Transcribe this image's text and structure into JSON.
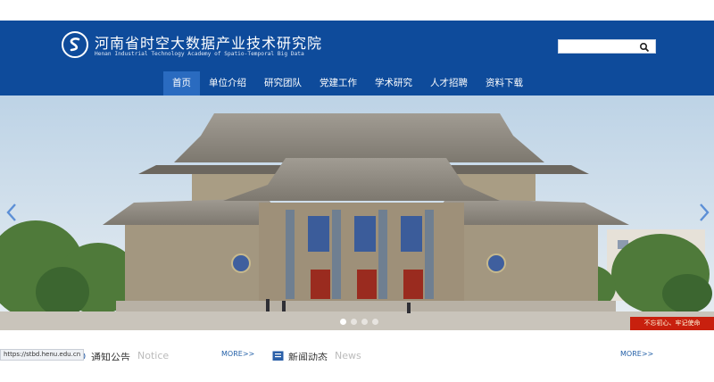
{
  "header": {
    "title": "河南省时空大数据产业技术研究院",
    "subtitle": "Henan Industrial Technology Academy of Spatio-Temporal Big Data",
    "search_placeholder": ""
  },
  "nav": {
    "items": [
      {
        "label": "首页"
      },
      {
        "label": "单位介绍"
      },
      {
        "label": "研究团队"
      },
      {
        "label": "党建工作"
      },
      {
        "label": "学术研究"
      },
      {
        "label": "人才招聘"
      },
      {
        "label": "资料下载"
      }
    ],
    "active_index": 0
  },
  "banner": {
    "slide_count": 4,
    "active_slide": 0,
    "slogan": "不忘初心、牢记使命"
  },
  "status_bar": {
    "url": "https://stbd.henu.edu.cn"
  },
  "sections": {
    "notice": {
      "title": "通知公告",
      "title_en": "Notice",
      "more": "MORE>>"
    },
    "news": {
      "title": "新闻动态",
      "title_en": "News",
      "more": "MORE>>"
    }
  },
  "colors": {
    "header_bg": "#0e4b9b",
    "nav_active": "#2a6bc0",
    "slogan_bg": "#c8200e"
  }
}
